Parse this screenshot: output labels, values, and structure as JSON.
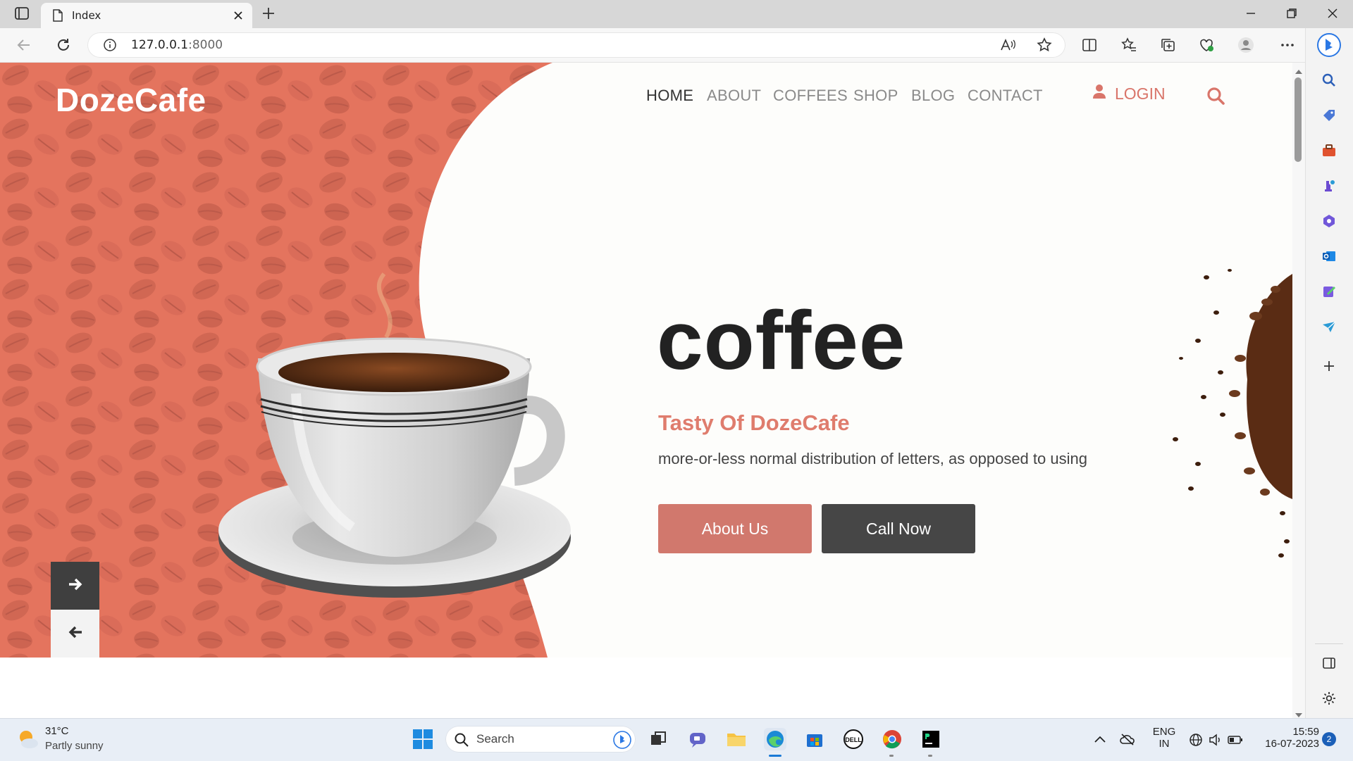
{
  "browser": {
    "tab_title": "Index",
    "url_host": "127.0.0.1",
    "url_port": ":8000"
  },
  "site": {
    "logo_part1": "Doze",
    "logo_part2": "Cafe",
    "nav": [
      "HOME",
      "ABOUT",
      "COFFEES",
      "SHOP",
      "BLOG",
      "CONTACT"
    ],
    "login_label": "LOGIN",
    "hero_title": "coffee",
    "hero_subtitle": "Tasty Of DozeCafe",
    "hero_description": "more-or-less normal distribution of letters, as opposed to using",
    "about_button": "About Us",
    "call_button": "Call Now"
  },
  "taskbar": {
    "weather_temp": "31°C",
    "weather_desc": "Partly sunny",
    "search_label": "Search",
    "lang_line1": "ENG",
    "lang_line2": "IN",
    "time": "15:59",
    "date": "16-07-2023",
    "notification_count": "2"
  },
  "colors": {
    "accent": "#df7c6d",
    "dark_button": "#464646",
    "beans": "#e06e58"
  }
}
